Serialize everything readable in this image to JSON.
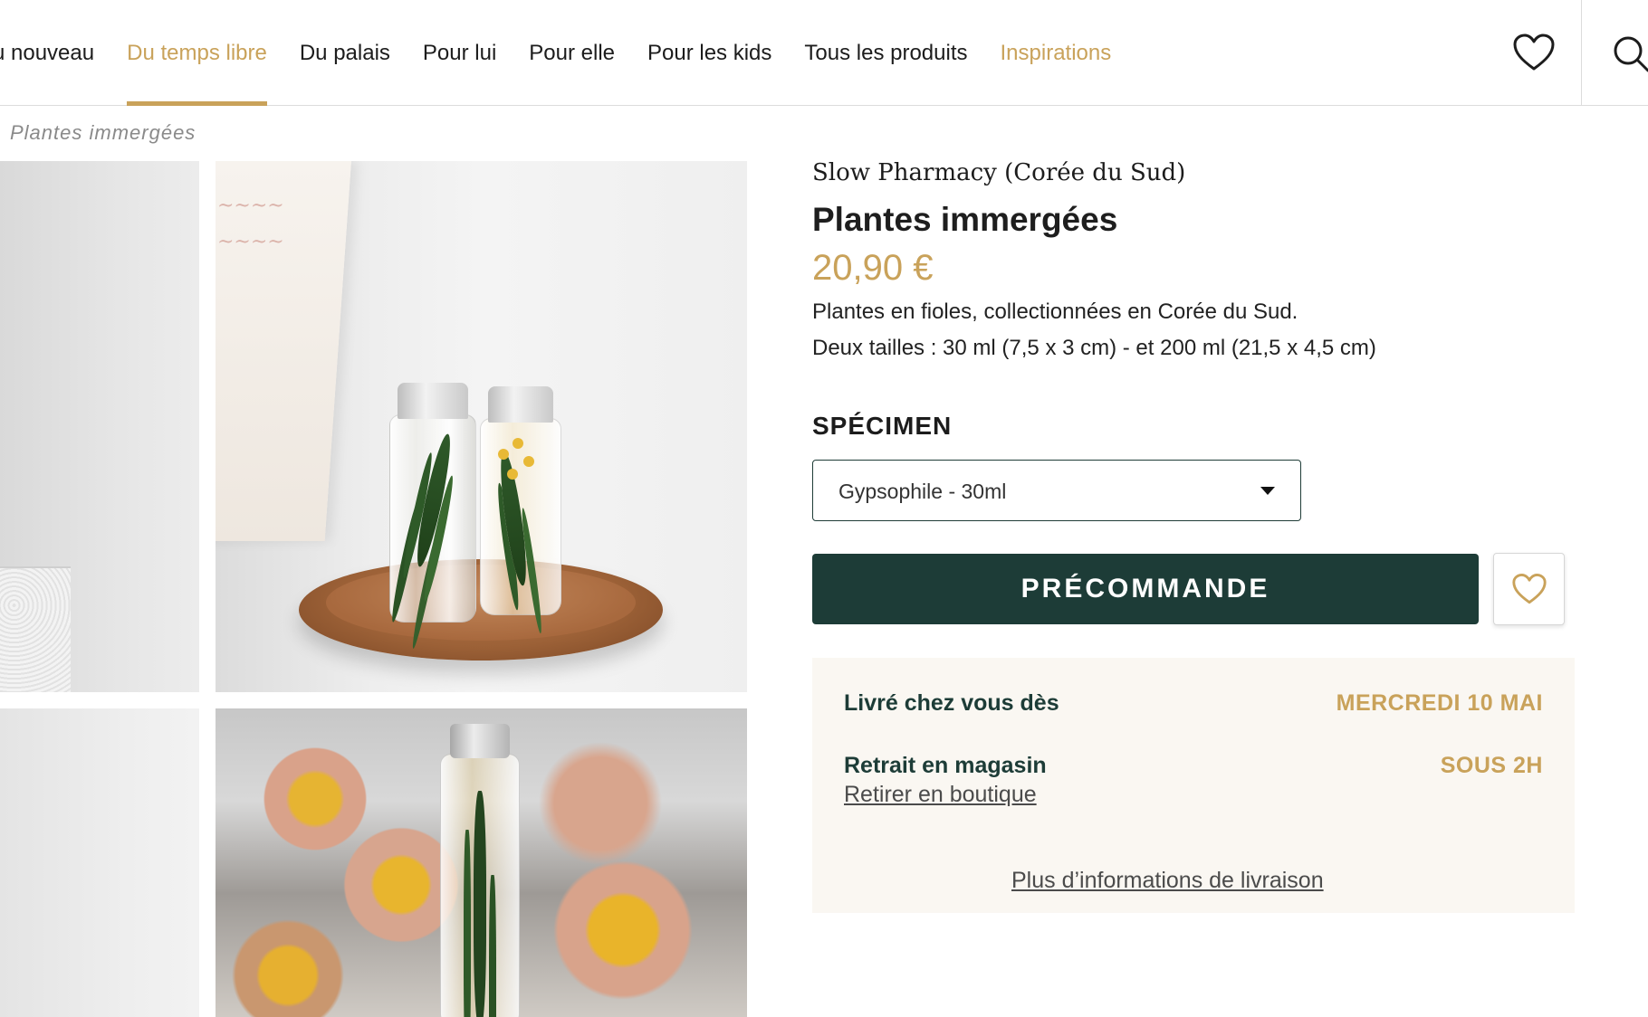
{
  "nav": {
    "items": [
      {
        "label": "u nouveau"
      },
      {
        "label": "Du temps libre"
      },
      {
        "label": "Du palais"
      },
      {
        "label": "Pour lui"
      },
      {
        "label": "Pour elle"
      },
      {
        "label": "Pour les kids"
      },
      {
        "label": "Tous les produits"
      },
      {
        "label": "Inspirations"
      }
    ],
    "active_index": 1,
    "accent_color": "#c9a25a"
  },
  "icons": {
    "wishlist": "heart-icon",
    "search": "search-icon",
    "dropdown": "caret-down-icon"
  },
  "breadcrumb": {
    "current": "Plantes immergées"
  },
  "product": {
    "brand": "Slow Pharmacy (Corée du Sud)",
    "title": "Plantes immergées",
    "price": "20,90 €",
    "description_line1": "Plantes en fioles, collectionnées en Corée du Sud.",
    "description_line2": "Deux tailles : 30 ml (7,5 x 3 cm) - et 200 ml (21,5 x 4,5 cm)"
  },
  "variant": {
    "label": "SPÉCIMEN",
    "selected": "Gypsophile - 30ml"
  },
  "actions": {
    "preorder_label": "PRÉCOMMANDE",
    "button_color": "#1d3c37"
  },
  "delivery": {
    "home_label": "Livré chez vous dès",
    "home_date": "MERCREDI 10 MAI",
    "pickup_label": "Retrait en magasin",
    "pickup_time": "SOUS 2H",
    "pickup_link": "Retirer en boutique",
    "more_info_link": "Plus d’informations de livraison",
    "panel_color": "#faf7f2"
  }
}
